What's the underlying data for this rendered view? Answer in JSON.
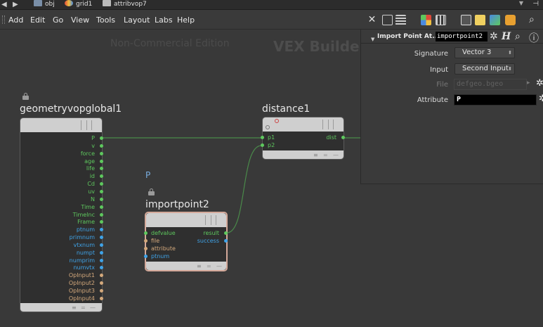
{
  "pathbar": {
    "obj_label": "obj",
    "grid_label": "grid1",
    "vop_label": "attribvop7"
  },
  "menubar": {
    "items": [
      "Add",
      "Edit",
      "Go",
      "View",
      "Tools",
      "Layout",
      "Labs",
      "Help"
    ]
  },
  "network": {
    "watermark": "Non-Commercial Edition",
    "context_label": "VEX Builder",
    "param_marker": "P",
    "nodes": {
      "global": {
        "title": "geometryvopglobal1",
        "outputs": [
          "P",
          "v",
          "force",
          "age",
          "life",
          "id",
          "Cd",
          "uv",
          "N",
          "Time",
          "TimeInc",
          "Frame",
          "ptnum",
          "primnum",
          "vtxnum",
          "numpt",
          "numprim",
          "numvtx",
          "OpInput1",
          "OpInput2",
          "OpInput3",
          "OpInput4"
        ]
      },
      "distance": {
        "title": "distance1",
        "inputs": [
          "p1",
          "p2"
        ],
        "outputs": [
          "dist"
        ]
      },
      "importpoint": {
        "title": "importpoint2",
        "inputs": [
          "defvalue",
          "file",
          "attribute",
          "ptnum"
        ],
        "outputs": [
          "result",
          "success"
        ]
      }
    },
    "colors": {
      "green_port": "#5ec85e",
      "blue_port": "#3fa3e8",
      "tan_port": "#d4a97c",
      "wire": "#4a8a4a",
      "selected_outline": "#d4a99a"
    }
  },
  "parms": {
    "node_type": "Import Point At...",
    "node_name": "importpoint2",
    "signature_label": "Signature",
    "signature_value": "Vector 3",
    "input_label": "Input",
    "input_value": "Second Input",
    "file_label": "File",
    "file_value": "defgeo.bgeo",
    "attribute_label": "Attribute",
    "attribute_value": "P"
  }
}
